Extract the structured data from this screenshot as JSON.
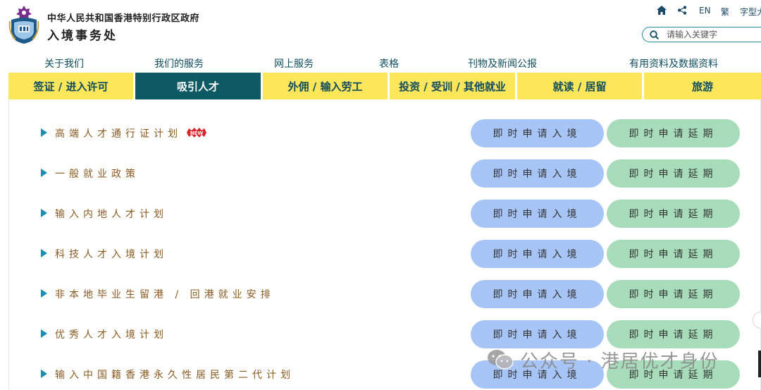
{
  "header": {
    "gov_name": "中华人民共和国香港特别行政区政府",
    "dept_name": "入境事务处"
  },
  "utility": {
    "home_icon": "home-icon",
    "share_icon": "share-icon",
    "lang_en": "EN",
    "lang_tc": "繁",
    "font_size": "字型大"
  },
  "search": {
    "placeholder": "请输入关键字",
    "icon": "search-icon"
  },
  "top_nav": [
    "关于我们",
    "我们的服务",
    "网上服务",
    "表格",
    "刊物及新闻公报",
    "有用资料及数据资料"
  ],
  "tabs": [
    {
      "label": "签证 / 进入许可",
      "active": false
    },
    {
      "label": "吸引人才",
      "active": true
    },
    {
      "label": "外佣 / 输入劳工",
      "active": false
    },
    {
      "label": "投资 / 受训 / 其他就业",
      "active": false
    },
    {
      "label": "就读 / 居留",
      "active": false
    },
    {
      "label": "旅游",
      "active": false
    }
  ],
  "rows": [
    {
      "label": "高端人才通行证计划",
      "new": true,
      "entry": "即时申请入境",
      "extend": "即时申请延期"
    },
    {
      "label": "一般就业政策",
      "new": false,
      "entry": "即时申请入境",
      "extend": "即时申请延期"
    },
    {
      "label": "输入内地人才计划",
      "new": false,
      "entry": "即时申请入境",
      "extend": "即时申请延期"
    },
    {
      "label": "科技人才入境计划",
      "new": false,
      "entry": "即时申请入境",
      "extend": "即时申请延期"
    },
    {
      "label": "非本地毕业生留港 / 回港就业安排",
      "new": false,
      "entry": "即时申请入境",
      "extend": "即时申请延期"
    },
    {
      "label": "优秀人才入境计划",
      "new": false,
      "entry": "即时申请入境",
      "extend": "即时申请延期"
    },
    {
      "label": "输入中国籍香港永久性居民第二代计划",
      "new": false,
      "entry": "即时申请入境",
      "extend": "即时申请延期"
    }
  ],
  "new_badge": "NEW",
  "watermark": {
    "text": "公众号 · 港居优才身份",
    "icon": "wechat-icon"
  },
  "colors": {
    "tab_yellow": "#fde65a",
    "tab_active": "#0e5a64",
    "btn_entry": "#a6c4f5",
    "btn_extend": "#a6dcba",
    "row_text": "#8a5a22",
    "arrow": "#1b8fb0"
  }
}
